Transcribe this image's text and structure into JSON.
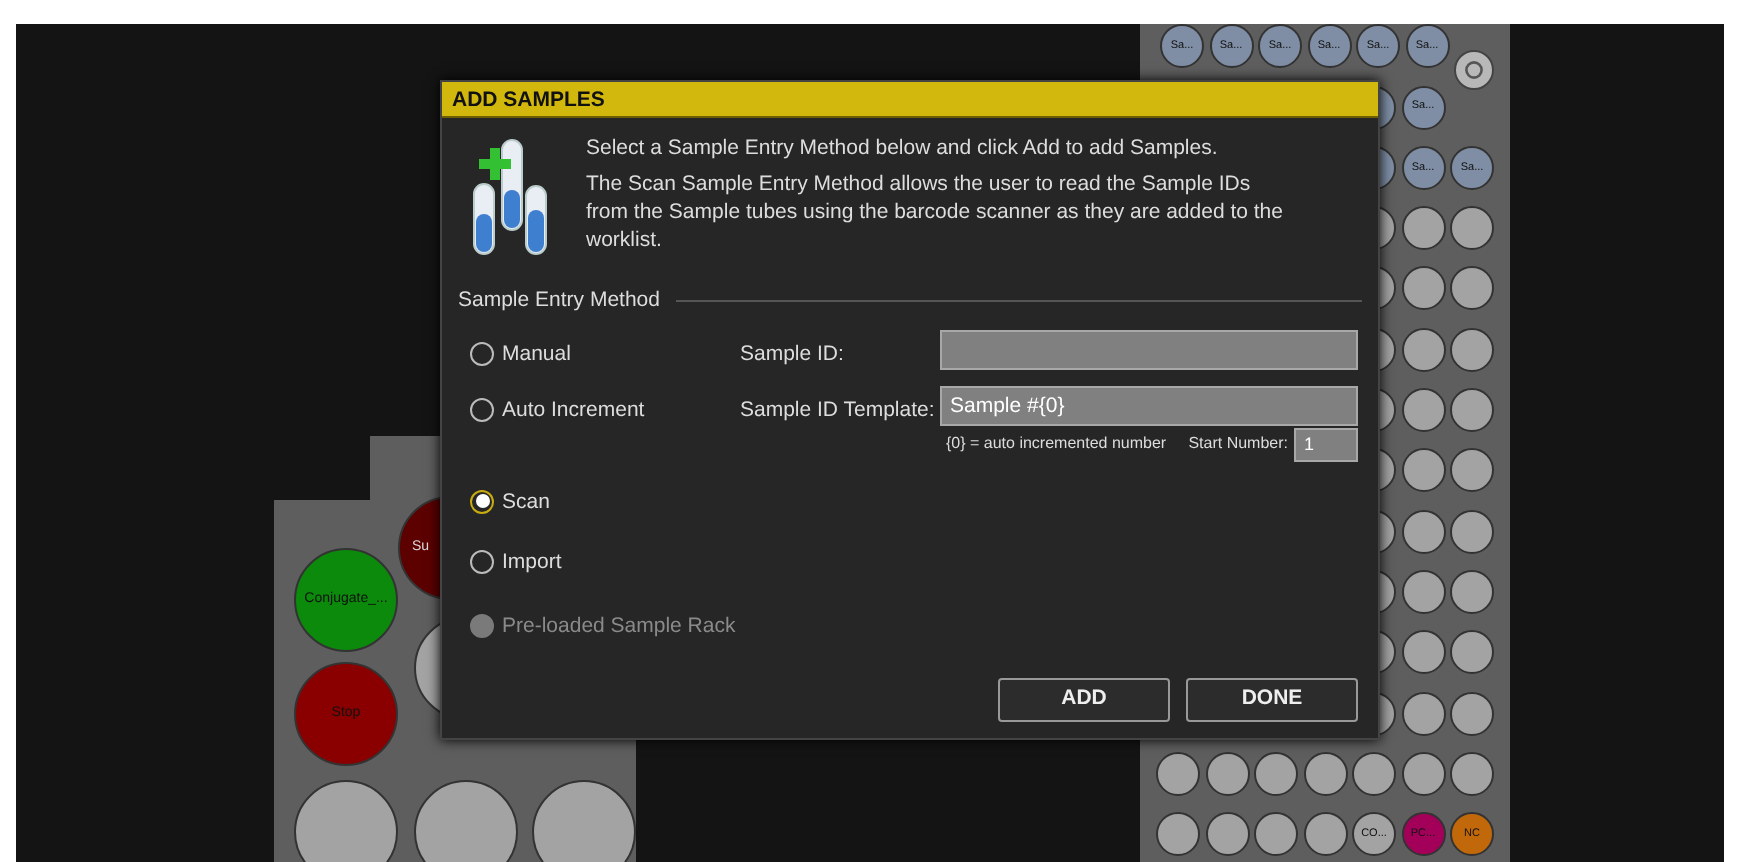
{
  "left_rack": {
    "wells": [
      {
        "label": "Conjugate_...",
        "color": "#0b8a0b"
      },
      {
        "label": "Su",
        "color": "#5c0000"
      },
      {
        "label": "Stop",
        "color": "#8a0000"
      },
      {
        "color": "#a3a3a3"
      },
      {
        "color": "#a3a3a3"
      },
      {
        "color": "#a3a3a3"
      },
      {
        "color": "#a3a3a3"
      }
    ]
  },
  "right_rack": {
    "rows": [
      [
        {
          "kind": "well",
          "label": "Sa...",
          "color": "#7f8ea5"
        },
        {
          "kind": "well",
          "label": "Sa...",
          "color": "#7f8ea5"
        },
        {
          "kind": "well",
          "label": "Sa...",
          "color": "#7f8ea5"
        },
        {
          "kind": "well",
          "label": "Sa...",
          "color": "#7f8ea5"
        },
        {
          "kind": "well",
          "label": "Sa...",
          "color": "#7f8ea5"
        },
        {
          "kind": "well",
          "label": "Sa...",
          "color": "#7f8ea5"
        },
        {
          "kind": "ring"
        }
      ],
      [
        {
          "kind": "empty"
        },
        {
          "kind": "empty"
        },
        {
          "kind": "empty"
        },
        {
          "kind": "empty"
        },
        {
          "kind": "well",
          "color": "#7f8ea5"
        },
        {
          "kind": "well",
          "label": "Sa...",
          "color": "#7f8ea5"
        },
        {
          "kind": "empty"
        }
      ],
      [
        {
          "kind": "empty"
        },
        {
          "kind": "empty"
        },
        {
          "kind": "empty"
        },
        {
          "kind": "empty"
        },
        {
          "kind": "well",
          "color": "#7f8ea5"
        },
        {
          "kind": "well",
          "label": "Sa...",
          "color": "#7f8ea5"
        },
        {
          "kind": "well",
          "label": "Sa...",
          "color": "#7f8ea5"
        }
      ],
      [
        {
          "kind": "empty"
        },
        {
          "kind": "empty"
        },
        {
          "kind": "empty"
        },
        {
          "kind": "empty"
        },
        {
          "kind": "well",
          "color": "#a3a3a3"
        },
        {
          "kind": "well",
          "color": "#a3a3a3"
        },
        {
          "kind": "well",
          "color": "#a3a3a3"
        }
      ],
      [
        {
          "kind": "empty"
        },
        {
          "kind": "empty"
        },
        {
          "kind": "empty"
        },
        {
          "kind": "empty"
        },
        {
          "kind": "well",
          "color": "#a3a3a3"
        },
        {
          "kind": "well",
          "color": "#a3a3a3"
        },
        {
          "kind": "well",
          "color": "#a3a3a3"
        }
      ],
      [
        {
          "kind": "empty"
        },
        {
          "kind": "empty"
        },
        {
          "kind": "empty"
        },
        {
          "kind": "empty"
        },
        {
          "kind": "well",
          "color": "#a3a3a3"
        },
        {
          "kind": "well",
          "color": "#a3a3a3"
        },
        {
          "kind": "well",
          "color": "#a3a3a3"
        }
      ],
      [
        {
          "kind": "empty"
        },
        {
          "kind": "empty"
        },
        {
          "kind": "empty"
        },
        {
          "kind": "empty"
        },
        {
          "kind": "well",
          "color": "#a3a3a3"
        },
        {
          "kind": "well",
          "color": "#a3a3a3"
        },
        {
          "kind": "well",
          "color": "#a3a3a3"
        }
      ],
      [
        {
          "kind": "empty"
        },
        {
          "kind": "empty"
        },
        {
          "kind": "empty"
        },
        {
          "kind": "empty"
        },
        {
          "kind": "well",
          "color": "#a3a3a3"
        },
        {
          "kind": "well",
          "color": "#a3a3a3"
        },
        {
          "kind": "well",
          "color": "#a3a3a3"
        }
      ],
      [
        {
          "kind": "empty"
        },
        {
          "kind": "empty"
        },
        {
          "kind": "empty"
        },
        {
          "kind": "empty"
        },
        {
          "kind": "well",
          "color": "#a3a3a3"
        },
        {
          "kind": "well",
          "color": "#a3a3a3"
        },
        {
          "kind": "well",
          "color": "#a3a3a3"
        }
      ],
      [
        {
          "kind": "empty"
        },
        {
          "kind": "empty"
        },
        {
          "kind": "empty"
        },
        {
          "kind": "empty"
        },
        {
          "kind": "well",
          "color": "#a3a3a3"
        },
        {
          "kind": "well",
          "color": "#a3a3a3"
        },
        {
          "kind": "well",
          "color": "#a3a3a3"
        }
      ],
      [
        {
          "kind": "empty"
        },
        {
          "kind": "empty"
        },
        {
          "kind": "empty"
        },
        {
          "kind": "empty"
        },
        {
          "kind": "well",
          "color": "#a3a3a3"
        },
        {
          "kind": "well",
          "color": "#a3a3a3"
        },
        {
          "kind": "well",
          "color": "#a3a3a3"
        }
      ],
      [
        {
          "kind": "empty"
        },
        {
          "kind": "empty"
        },
        {
          "kind": "empty"
        },
        {
          "kind": "empty"
        },
        {
          "kind": "well",
          "color": "#a3a3a3"
        },
        {
          "kind": "well",
          "color": "#a3a3a3"
        },
        {
          "kind": "well",
          "color": "#a3a3a3"
        }
      ],
      [
        {
          "kind": "well",
          "color": "#a3a3a3"
        },
        {
          "kind": "well",
          "color": "#a3a3a3"
        },
        {
          "kind": "well",
          "color": "#a3a3a3"
        },
        {
          "kind": "well",
          "color": "#a3a3a3"
        },
        {
          "kind": "well",
          "color": "#a3a3a3"
        },
        {
          "kind": "well",
          "color": "#a3a3a3"
        },
        {
          "kind": "well",
          "color": "#a3a3a3"
        }
      ],
      [
        {
          "kind": "well",
          "color": "#a3a3a3"
        },
        {
          "kind": "well",
          "color": "#a3a3a3"
        },
        {
          "kind": "well",
          "color": "#a3a3a3"
        },
        {
          "kind": "well",
          "color": "#a3a3a3"
        },
        {
          "kind": "well",
          "label": "CO...",
          "color": "#a3a3a3"
        },
        {
          "kind": "well",
          "label": "PC...",
          "color": "#a3005a"
        },
        {
          "kind": "well",
          "label": "NC",
          "color": "#c0680a"
        }
      ]
    ]
  },
  "dialog": {
    "title": "ADD SAMPLES",
    "intro": "Select a Sample Entry Method below and click Add to add Samples.",
    "description": "The Scan Sample Entry Method allows the user to read the Sample IDs from the Sample tubes using the barcode scanner as they are added to the worklist.",
    "section_title": "Sample Entry Method",
    "methods": [
      {
        "label": "Manual",
        "selected": false,
        "disabled": false
      },
      {
        "label": "Auto Increment",
        "selected": false,
        "disabled": false
      },
      {
        "label": "Scan",
        "selected": true,
        "disabled": false
      },
      {
        "label": "Import",
        "selected": false,
        "disabled": false
      },
      {
        "label": "Pre-loaded Sample Rack",
        "selected": false,
        "disabled": true
      }
    ],
    "sample_id": {
      "label": "Sample ID:"
    },
    "template": {
      "label": "Sample ID Template:",
      "value": "Sample #{0}"
    },
    "template_hint": "{0} = auto incremented number",
    "start_number": {
      "label": "Start Number:",
      "value": "1"
    },
    "buttons": [
      "ADD",
      "DONE"
    ]
  }
}
